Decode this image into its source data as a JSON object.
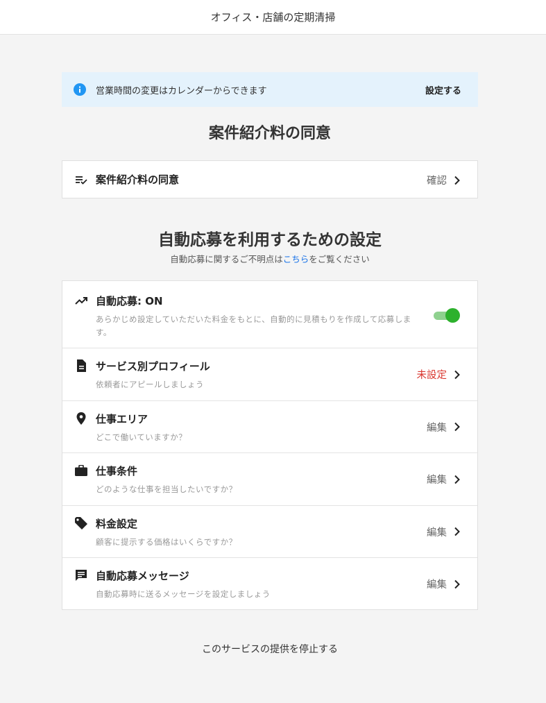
{
  "header": {
    "title": "オフィス・店舗の定期清掃"
  },
  "banner": {
    "icon": "info-icon",
    "text": "営業時間の変更はカレンダーからできます",
    "action": "設定する",
    "colors": {
      "background": "#e4f2fc",
      "icon": "#2196f3"
    }
  },
  "consent_section": {
    "title": "案件紹介料の同意",
    "row": {
      "icon": "checklist-icon",
      "label": "案件紹介料の同意",
      "action": "確認"
    }
  },
  "auto_apply_section": {
    "title": "自動応募を利用するための設定",
    "subtitle_before": "自動応募に関するご不明点は",
    "subtitle_link": "こちら",
    "subtitle_after": "をご覧ください",
    "auto_row": {
      "icon": "trending-up-icon",
      "label": "自動応募: ON",
      "desc": "あらかじめ設定していただいた料金をもとに、自動的に見積もりを作成して応募します。",
      "toggle_on": true
    },
    "rows": [
      {
        "icon": "document-icon",
        "label": "サービス別プロフィール",
        "desc": "依頼者にアピールしましょう",
        "action": "未設定"
      },
      {
        "icon": "location-pin-icon",
        "label": "仕事エリア",
        "desc": "どこで働いていますか？",
        "action": "編集"
      },
      {
        "icon": "briefcase-icon",
        "label": "仕事条件",
        "desc": "どのような仕事を担当したいですか？",
        "action": "編集"
      },
      {
        "icon": "price-tag-icon",
        "label": "料金設定",
        "desc": "顧客に提示する価格はいくらですか？",
        "action": "編集"
      },
      {
        "icon": "message-icon",
        "label": "自動応募メッセージ",
        "desc": "自動応募時に送るメッセージを設定しましょう",
        "action": "編集"
      }
    ]
  },
  "footer": {
    "stop_link": "このサービスの提供を停止する"
  },
  "colors": {
    "warning": "#d9372f",
    "toggle_on": "#2db12d",
    "link": "#1a73e8"
  }
}
